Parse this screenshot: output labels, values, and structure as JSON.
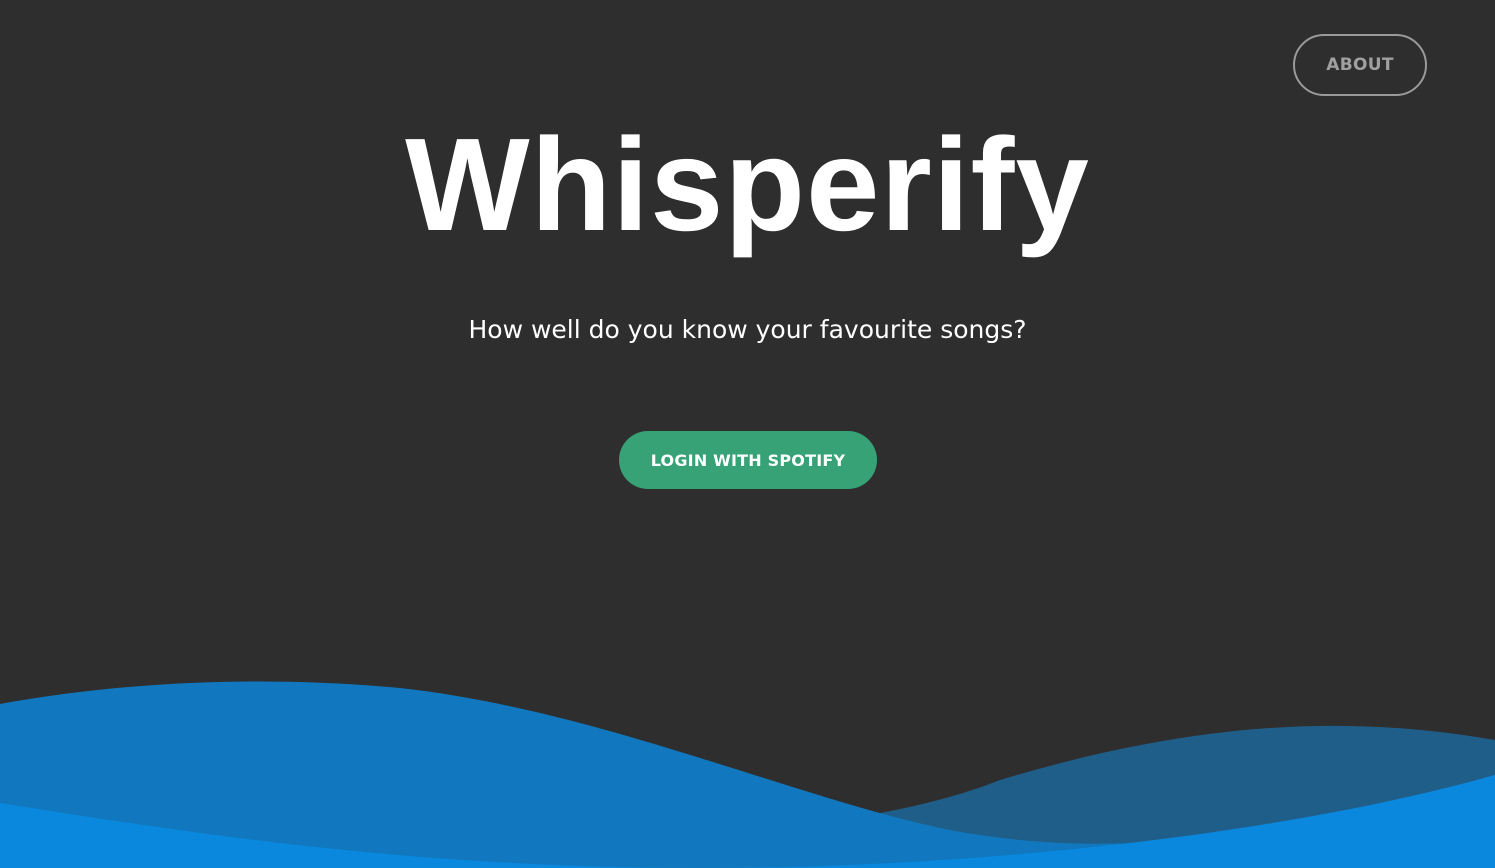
{
  "header": {
    "about_label": "ABOUT"
  },
  "hero": {
    "title": "Whisperify",
    "subtitle": "How well do you know your favourite songs?",
    "login_label": "LOGIN WITH SPOTIFY"
  },
  "colors": {
    "background": "#2e2e2e",
    "accent_green": "#37a276",
    "wave_dark_blue": "#205e8a",
    "wave_mid_blue": "#1178bf",
    "wave_bright_blue": "#0a88de"
  }
}
